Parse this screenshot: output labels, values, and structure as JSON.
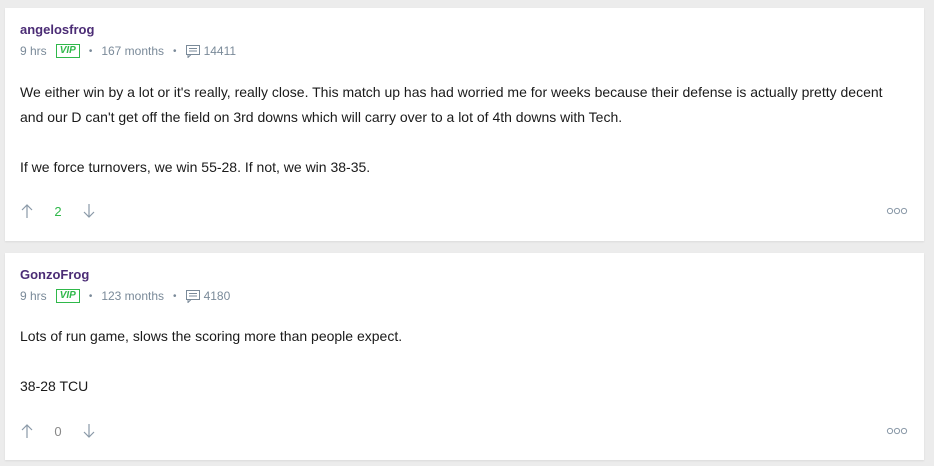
{
  "posts": [
    {
      "username": "angelosfrog",
      "time": "9 hrs",
      "badge": "VIP",
      "tenure": "167 months",
      "comment_count": "14411",
      "paragraphs": [
        "We either win by a lot or it's really, really close. This match up has had worried me for weeks because their defense is actually pretty decent and our D can't get off the field on 3rd downs which will carry over to a lot of 4th downs with Tech.",
        "If we force turnovers, we win 55-28. If not, we win 38-35."
      ],
      "score": "2"
    },
    {
      "username": "GonzoFrog",
      "time": "9 hrs",
      "badge": "VIP",
      "tenure": "123 months",
      "comment_count": "4180",
      "paragraphs": [
        "Lots of run game, slows the scoring more than people expect.",
        "38-28 TCU"
      ],
      "score": "0"
    }
  ],
  "icons": {
    "upvote": "arrow-up-icon",
    "downvote": "arrow-down-icon",
    "comments": "comment-icon",
    "more": "more-options-icon"
  },
  "colors": {
    "username": "#4b2c75",
    "vip": "#2fb84a",
    "score_positive": "#2fb84a",
    "meta": "#7a8a99"
  }
}
